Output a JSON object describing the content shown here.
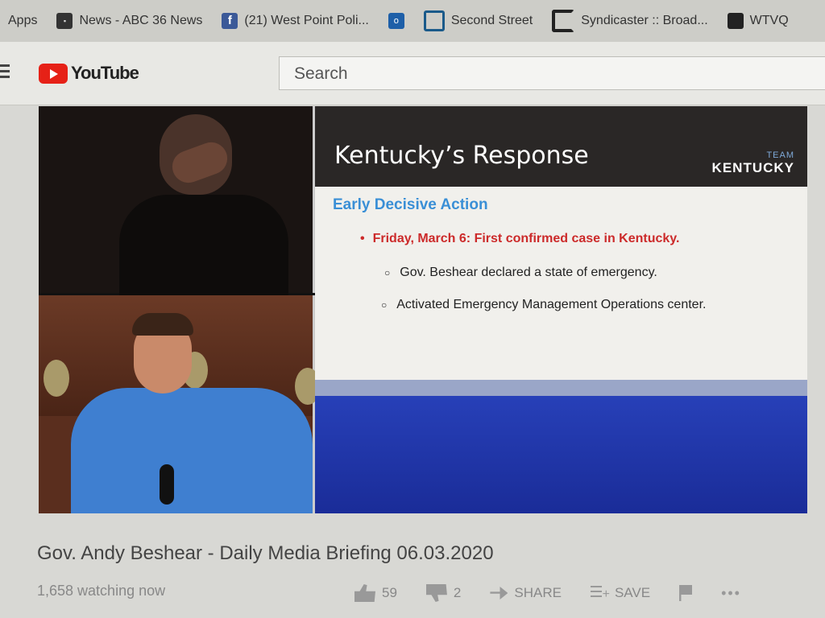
{
  "bookmarks": {
    "apps": "Apps",
    "items": [
      {
        "label": "News - ABC 36 News",
        "icon": "news-icon"
      },
      {
        "label": "(21) West Point Poli...",
        "icon": "facebook-icon"
      },
      {
        "label": "",
        "icon": "outlook-icon"
      },
      {
        "label": "Second Street",
        "icon": "second-street-icon"
      },
      {
        "label": "Syndicaster :: Broad...",
        "icon": "syndicaster-icon"
      },
      {
        "label": "WTVQ",
        "icon": "wtvq-icon"
      }
    ]
  },
  "header": {
    "logo_text": "YouTube",
    "search_placeholder": "Search"
  },
  "slide": {
    "title": "Kentucky’s Response",
    "brand_team": "TEAM",
    "brand_state": "KENTUCKY",
    "subtitle": "Early Decisive Action",
    "bullet_main": "Friday, March 6: First confirmed case in Kentucky.",
    "bullet_sub_1": "Gov. Beshear declared a state of emergency.",
    "bullet_sub_2": "Activated Emergency Management Operations center."
  },
  "video": {
    "title": "Gov. Andy Beshear - Daily Media Briefing 06.03.2020",
    "watching": "1,658 watching now"
  },
  "actions": {
    "likes": "59",
    "dislikes": "2",
    "share_label": "SHARE",
    "save_label": "SAVE"
  },
  "colors": {
    "youtube_red": "#e62117",
    "slide_heading_blue": "#3a8fd6",
    "slide_red": "#cc2a2a"
  }
}
